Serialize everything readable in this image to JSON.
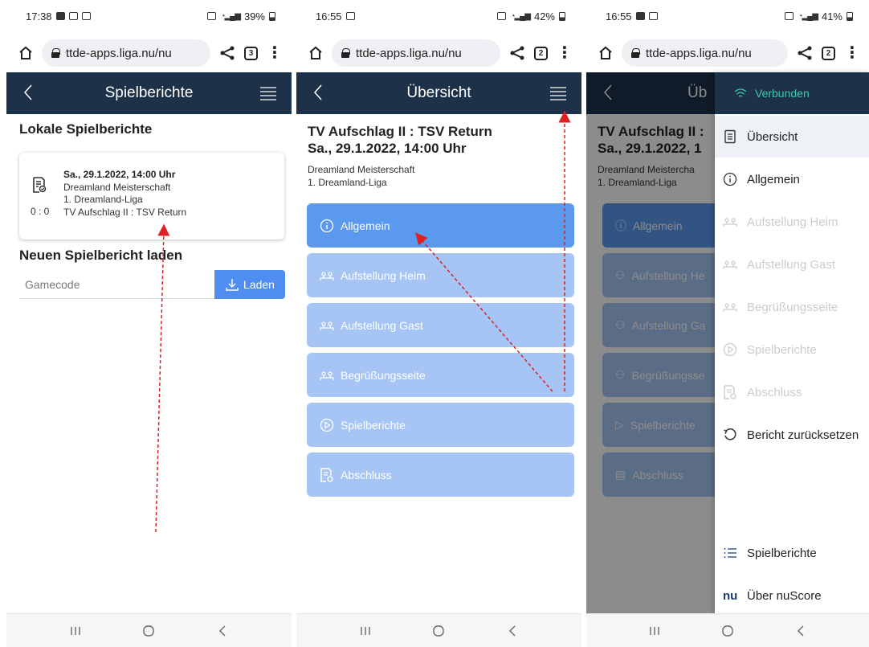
{
  "panels": [
    {
      "status": {
        "time": "17:38",
        "battery": "39%"
      },
      "browser": {
        "url": "ttde-apps.liga.nu/nu",
        "tabs": "3"
      },
      "appbar": {
        "title": "Spielberichte"
      },
      "local_heading": "Lokale Spielberichte",
      "card": {
        "date": "Sa., 29.1.2022, 14:00 Uhr",
        "championship": "Dreamland Meisterschaft",
        "league": "1. Dreamland-Liga",
        "teams": "TV Aufschlag II : TSV Return",
        "score": "0 : 0"
      },
      "load_heading": "Neuen Spielbericht laden",
      "gamecode_placeholder": "Gamecode",
      "load_button": "Laden"
    },
    {
      "status": {
        "time": "16:55",
        "battery": "42%"
      },
      "browser": {
        "url": "ttde-apps.liga.nu/nu",
        "tabs": "2"
      },
      "appbar": {
        "title": "Übersicht"
      },
      "match_title": "TV Aufschlag II : TSV Return",
      "match_date": "Sa., 29.1.2022, 14:00 Uhr",
      "match_championship": "Dreamland Meisterschaft",
      "match_league": "1. Dreamland-Liga",
      "menu": [
        {
          "label": "Allgemein",
          "icon": "info-icon"
        },
        {
          "label": "Aufstellung Heim",
          "icon": "team-icon"
        },
        {
          "label": "Aufstellung Gast",
          "icon": "team-icon"
        },
        {
          "label": "Begrüßungsseite",
          "icon": "team-icon"
        },
        {
          "label": "Spielberichte",
          "icon": "play-icon"
        },
        {
          "label": "Abschluss",
          "icon": "document-icon"
        }
      ]
    },
    {
      "status": {
        "time": "16:55",
        "battery": "41%"
      },
      "browser": {
        "url": "ttde-apps.liga.nu/nu",
        "tabs": "2"
      },
      "bg_title_fragment": "Üb",
      "bg_match_title": "TV Aufschlag II :",
      "bg_match_date": "Sa., 29.1.2022, 1",
      "bg_championship": "Dreamland Meistercha",
      "bg_league": "1. Dreamland-Liga",
      "bg_menu": [
        "Allgemein",
        "Aufstellung He",
        "Aufstellung Ga",
        "Begrüßungsse",
        "Spielberichte",
        "Abschluss"
      ],
      "drawer": {
        "connection": "Verbunden",
        "items": [
          {
            "label": "Übersicht",
            "state": "active"
          },
          {
            "label": "Allgemein",
            "state": "enabled"
          },
          {
            "label": "Aufstellung Heim",
            "state": "disabled"
          },
          {
            "label": "Aufstellung Gast",
            "state": "disabled"
          },
          {
            "label": "Begrüßungsseite",
            "state": "disabled"
          },
          {
            "label": "Spielberichte",
            "state": "disabled"
          },
          {
            "label": "Abschluss",
            "state": "disabled"
          },
          {
            "label": "Bericht zurücksetzen",
            "state": "enabled"
          }
        ],
        "bottom_items": [
          {
            "label": "Spielberichte"
          },
          {
            "label": "Über nuScore",
            "logo": "nu"
          }
        ]
      }
    }
  ],
  "colors": {
    "appbar": "#1d3249",
    "primary_button": "#5b99ee",
    "secondary_button": "#a6c5f5",
    "connected": "#3ec9a7",
    "annotation_arrow": "#e02020"
  }
}
